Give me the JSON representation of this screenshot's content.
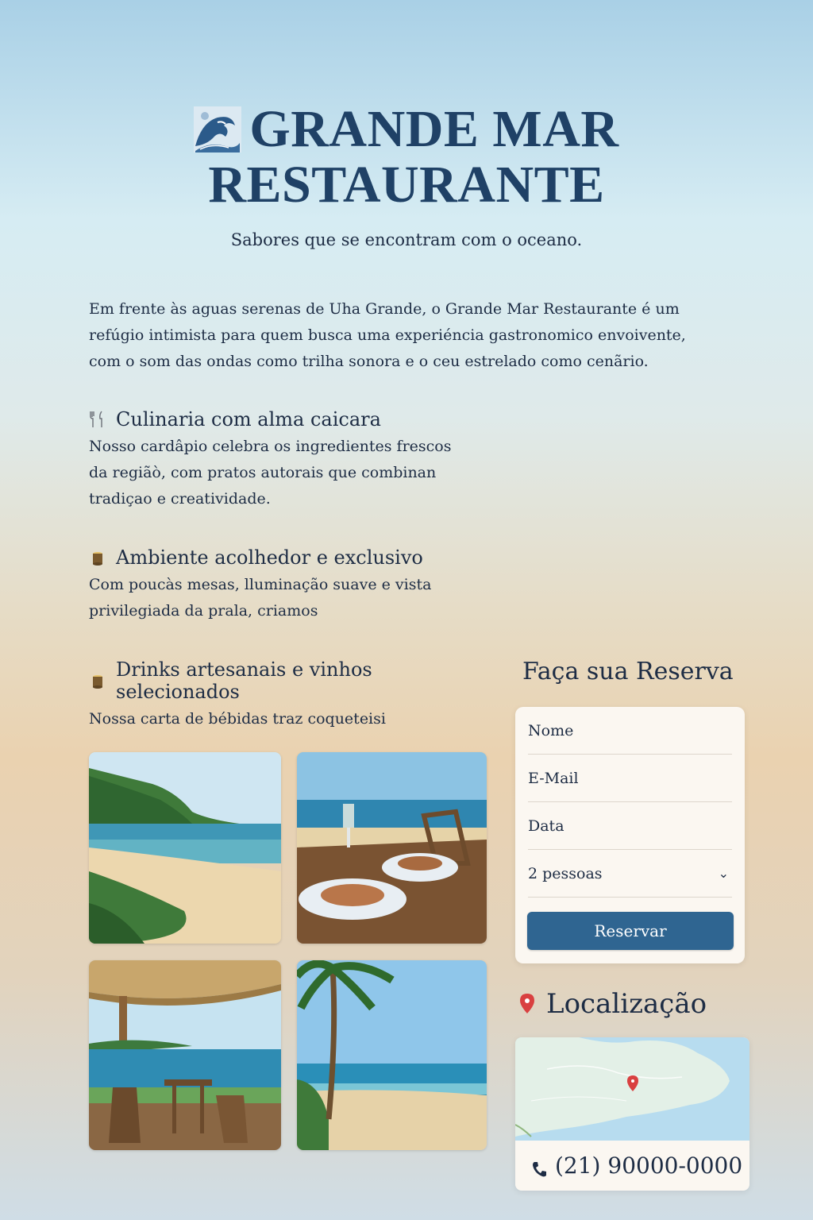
{
  "header": {
    "title_line1": "GRANDE MAR",
    "title_line2": "RESTAURANTE",
    "tagline": "Sabores que se encontram com o oceano.",
    "logo_icon": "wave-icon"
  },
  "intro": "Em frente às aguas serenas de Uha Grande, o Grande Mar Restaurante é um refúgio intimista para quem busca uma experiéncia gastronomico envoivente, com o som das ondas como trilha sonora e o ceu estrelado como cenãrio.",
  "features": [
    {
      "icon": "cutlery-icon",
      "title": "Culinaria com alma caicara",
      "text": "Nosso cardâpio celebra os ingredientes frescos da regiãò, com pratos autorais que combinan tradiçao e creatividade."
    },
    {
      "icon": "candle-icon",
      "title": "Ambiente acolhedor e exclusivo",
      "text": "Com poucàs mesas, lluminação suave e vista privilegiada da prala, criamos"
    },
    {
      "icon": "candle-icon",
      "title": "Drinks artesanais e vinhos selecionados",
      "text": "Nossa carta de bébidas traz coqueteisi"
    }
  ],
  "gallery": [
    {
      "subject": "beach-hill-photo"
    },
    {
      "subject": "dinner-table-photo"
    },
    {
      "subject": "terrace-photo"
    },
    {
      "subject": "palm-beach-photo"
    }
  ],
  "reservation": {
    "title": "Faça sua Reserva",
    "name_placeholder": "Nome",
    "email_placeholder": "E-Mail",
    "date_placeholder": "Data",
    "guests_selected": "2 pessoas",
    "button_label": "Reservar"
  },
  "location": {
    "title": "Localização",
    "phone": "(21) 90000-0000"
  },
  "colors": {
    "title": "#1f4166",
    "button": "#2f6591",
    "text": "#1d2c44"
  }
}
